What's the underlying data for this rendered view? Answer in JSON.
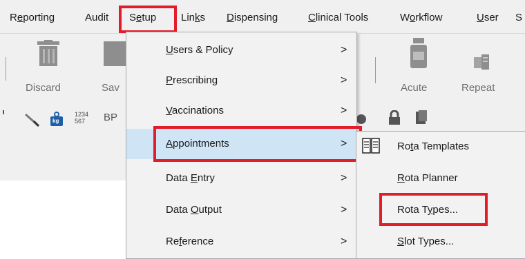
{
  "menubar": {
    "items": [
      {
        "name": "reporting",
        "label": "Reporting"
      },
      {
        "name": "audit",
        "label": "Audit"
      },
      {
        "name": "setup",
        "label": "Setup"
      },
      {
        "name": "links",
        "label": "Links"
      },
      {
        "name": "dispensing",
        "label": "Dispensing"
      },
      {
        "name": "clinical-tools",
        "label": "Clinical Tools"
      },
      {
        "name": "workflow",
        "label": "Workflow"
      },
      {
        "name": "user",
        "label": "User"
      },
      {
        "name": "s",
        "label": "S"
      }
    ]
  },
  "toolbar": {
    "discard_label": "Discard",
    "save_label": "Sav",
    "acute_label": "Acute",
    "repeat_label": "Repeat",
    "bp_label": "BP",
    "numbers_glyph": "1234 567",
    "kg_label": "kg"
  },
  "setup_menu": {
    "items": [
      {
        "label": "Users & Policy",
        "has_submenu": true
      },
      {
        "label": "Prescribing",
        "has_submenu": true
      },
      {
        "label": "Vaccinations",
        "has_submenu": true
      },
      {
        "label": "Appointments",
        "has_submenu": true,
        "selected": true
      },
      {
        "label": "Data Entry",
        "has_submenu": true
      },
      {
        "label": "Data Output",
        "has_submenu": true
      },
      {
        "label": "Reference",
        "has_submenu": true
      }
    ],
    "chevron": ">"
  },
  "appointments_submenu": {
    "items": [
      {
        "label": "Rota Templates",
        "icon": "book-icon"
      },
      {
        "label": "Rota Planner"
      },
      {
        "label": "Rota Types..."
      },
      {
        "label": "Slot Types..."
      }
    ]
  },
  "colors": {
    "highlight_box": "#e31c2a",
    "menu_selected": "#cfe5f6",
    "menu_background": "#f2f2f2"
  }
}
